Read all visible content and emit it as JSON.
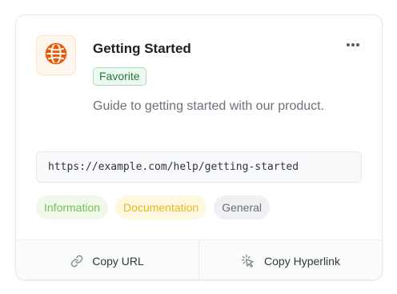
{
  "card": {
    "title": "Getting Started",
    "badge": "Favorite",
    "description": "Guide to getting started with our product.",
    "url": "https://example.com/help/getting-started",
    "icon": "globe-icon",
    "menu_icon": "more-horizontal-icon",
    "tags": [
      {
        "label": "Information",
        "color": "#78c05a"
      },
      {
        "label": "Documentation",
        "color": "#e8b81d"
      },
      {
        "label": "General",
        "color": "#6b6f76"
      }
    ],
    "actions": {
      "copy_url": {
        "label": "Copy URL",
        "icon": "link-icon"
      },
      "copy_hyperlink": {
        "label": "Copy Hyperlink",
        "icon": "sparkle-click-icon"
      }
    }
  },
  "colors": {
    "accent_orange": "#e8590c",
    "favorite_green": "#1e7b3c"
  }
}
